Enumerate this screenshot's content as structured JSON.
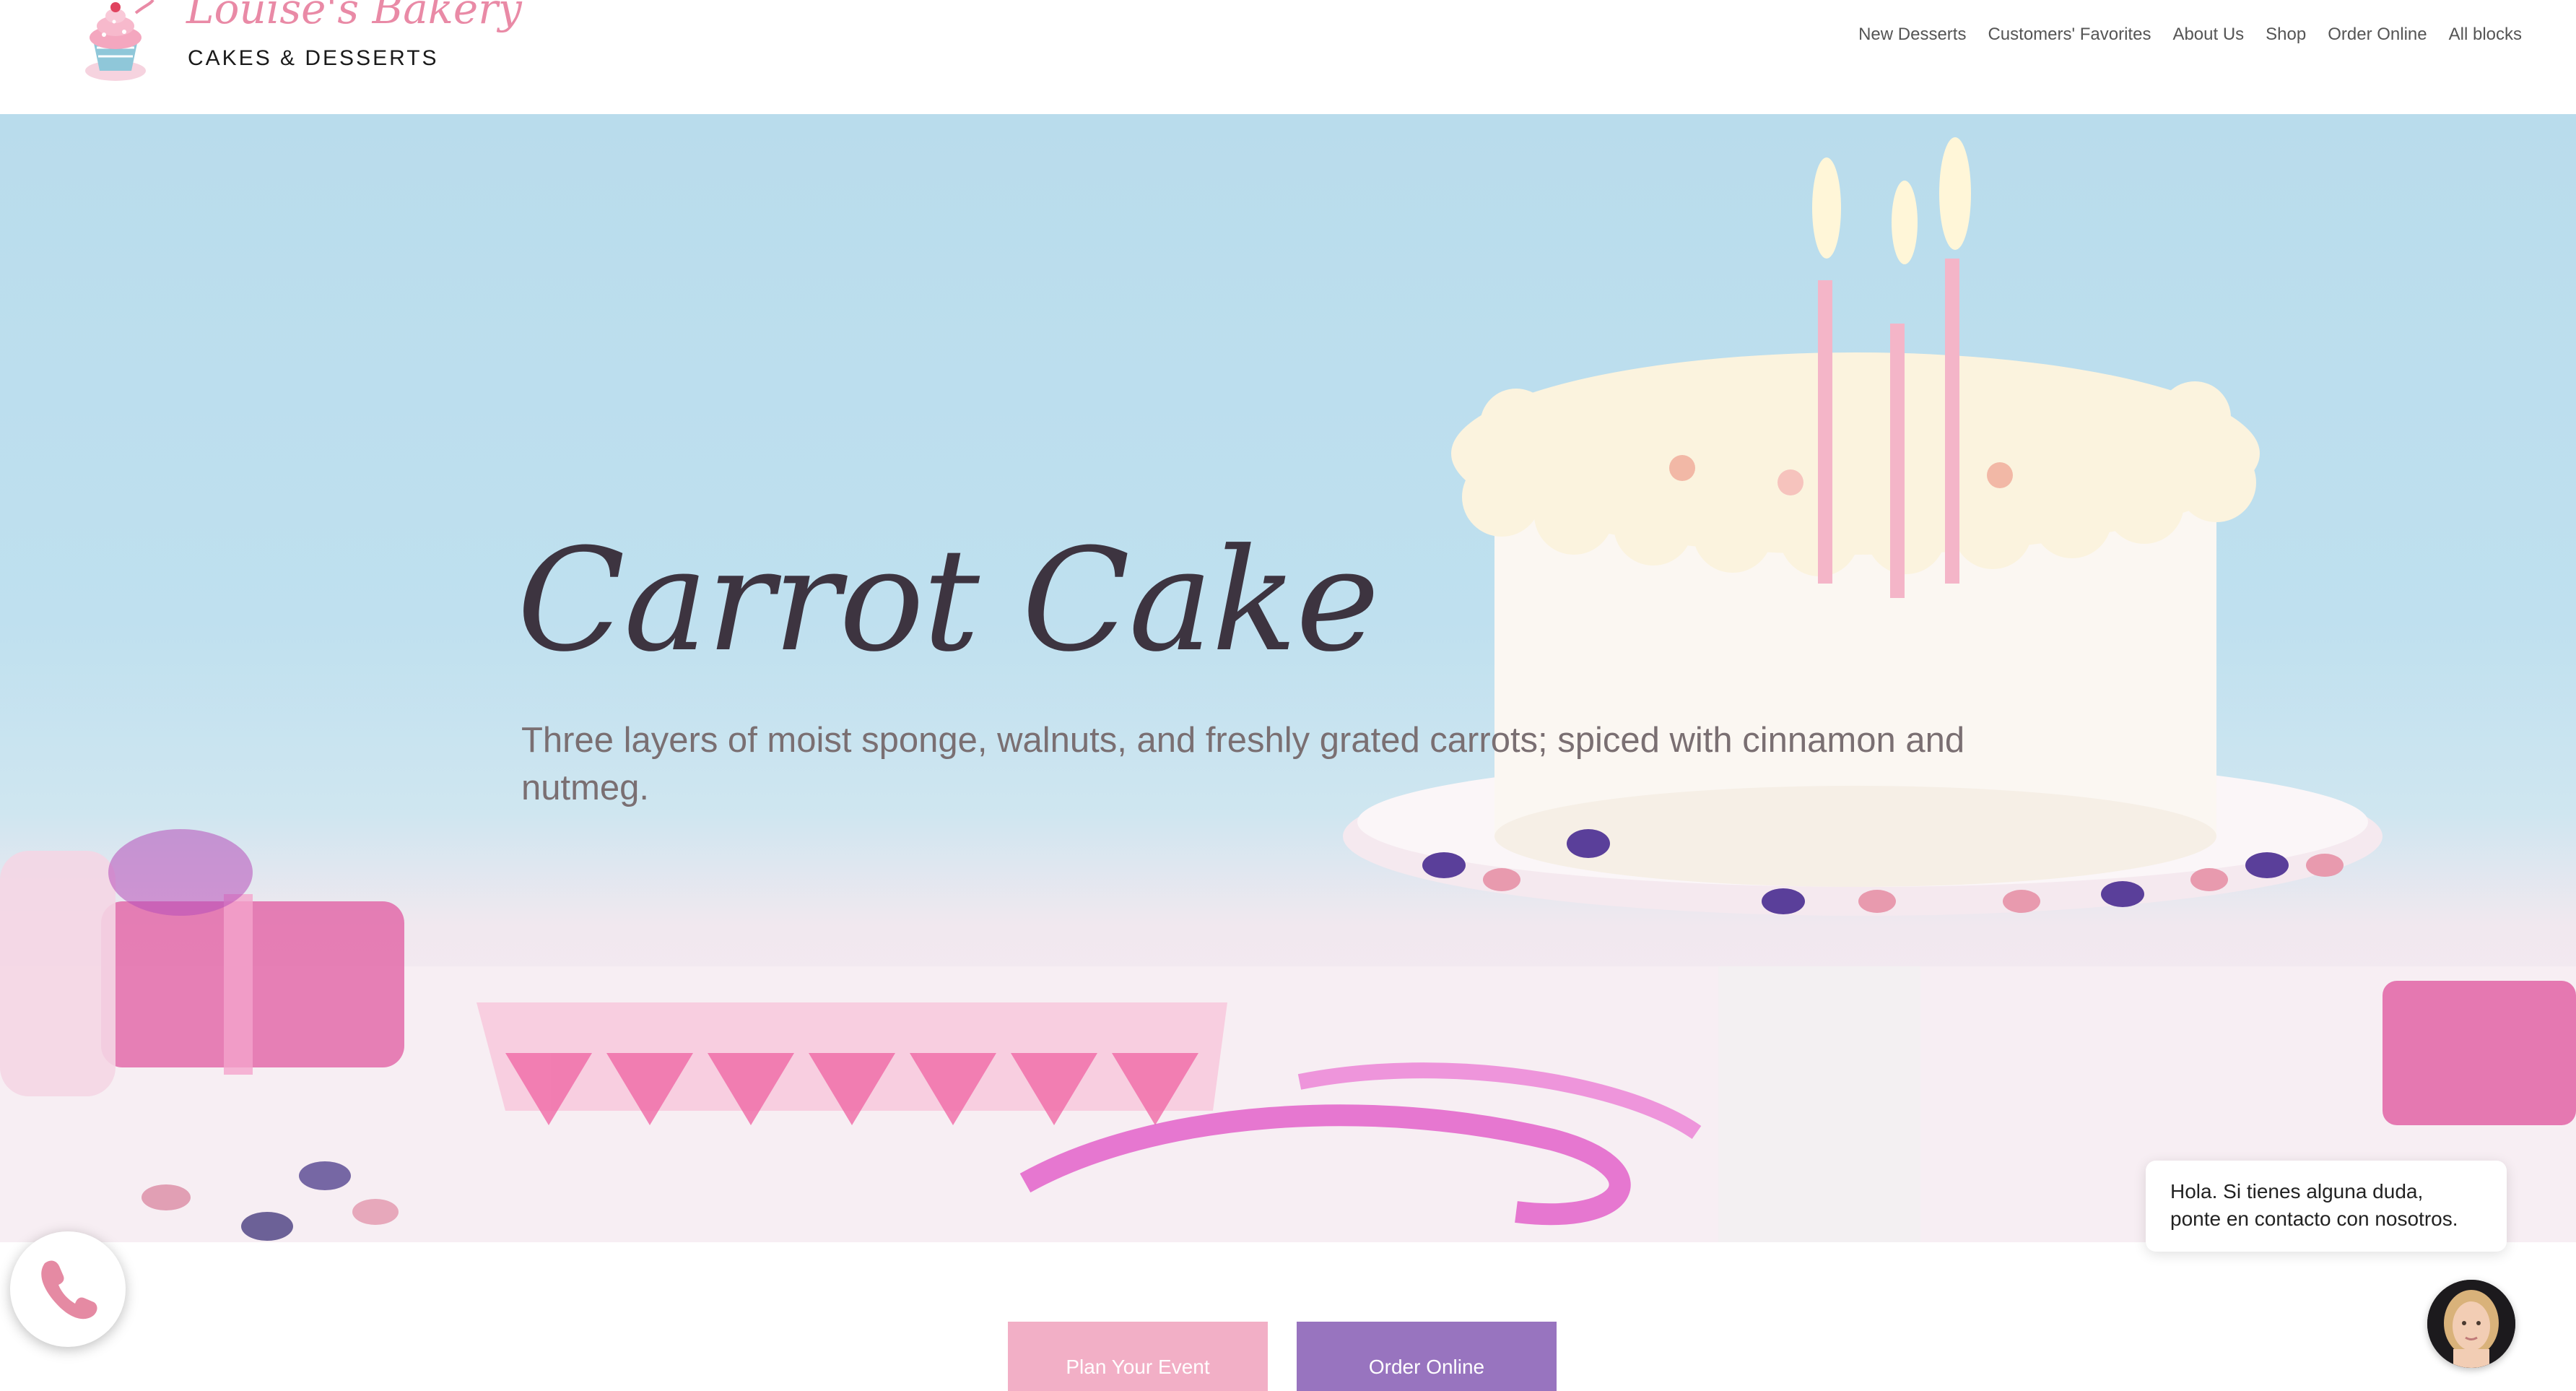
{
  "brand": {
    "name": "Louise's Bakery",
    "tagline": "CAKES & DESSERTS"
  },
  "nav": {
    "items": [
      {
        "label": "New Desserts"
      },
      {
        "label": "Customers' Favorites"
      },
      {
        "label": "About Us"
      },
      {
        "label": "Shop"
      },
      {
        "label": "Order Online"
      },
      {
        "label": "All blocks"
      }
    ]
  },
  "hero": {
    "title": "Carrot Cake",
    "subtitle": "Three layers of moist sponge, walnuts, and freshly grated carrots; spiced with cinnamon and nutmeg."
  },
  "cta": {
    "plan_label": "Plan Your Event",
    "order_label": "Order Online"
  },
  "chat": {
    "message_line1": "Hola. Si tienes alguna duda,",
    "message_line2": "ponte en contacto con nosotros."
  },
  "icons": {
    "phone": "phone-icon",
    "logo": "cupcake-icon"
  },
  "colors": {
    "brand_pink": "#e98aa6",
    "plan_button": "#f2afc6",
    "order_button": "#9874bf",
    "hero_sky": "#b9dcec"
  }
}
